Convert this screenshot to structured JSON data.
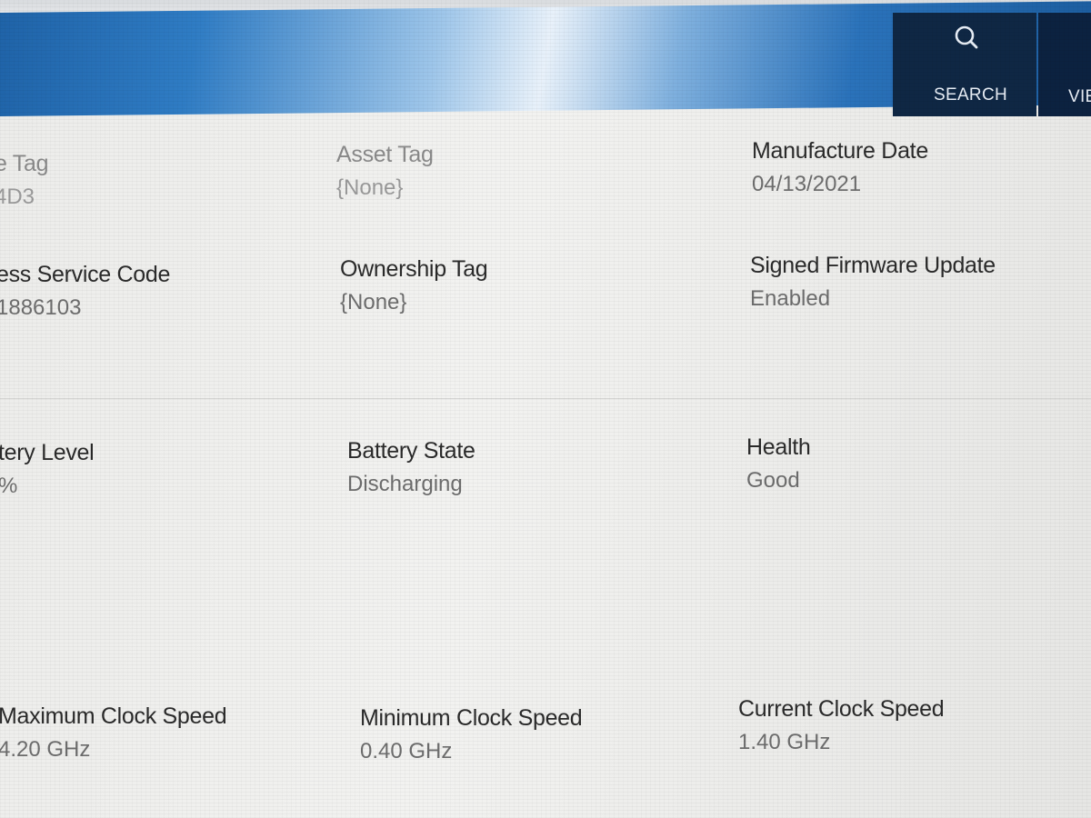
{
  "nav": {
    "search_label": "SEARCH",
    "view_label": "VIE"
  },
  "colors": {
    "header_blue": "#2f7cc4",
    "nav_dark": "#0f2744",
    "label_text": "#2a2a2a",
    "value_text": "#6d6d6d"
  },
  "icons": {
    "search": "search-icon"
  },
  "system_info": {
    "service_tag": {
      "label": "e Tag",
      "value": "4D3"
    },
    "asset_tag": {
      "label": "Asset Tag",
      "value": "{None}"
    },
    "manufacture_date": {
      "label": "Manufacture Date",
      "value": "04/13/2021"
    },
    "express_service_code": {
      "label": "ess Service Code",
      "value": "1886103"
    },
    "ownership_tag": {
      "label": "Ownership Tag",
      "value": "{None}"
    },
    "signed_firmware_update": {
      "label": "Signed Firmware Update",
      "value": "Enabled"
    }
  },
  "battery_info": {
    "battery_level": {
      "label": "tery Level",
      "value": "%"
    },
    "battery_state": {
      "label": "Battery State",
      "value": "Discharging"
    },
    "health": {
      "label": "Health",
      "value": "Good"
    }
  },
  "processor_info": {
    "maximum_clock_speed": {
      "label": "Maximum Clock Speed",
      "value": "4.20 GHz"
    },
    "minimum_clock_speed": {
      "label": "Minimum Clock Speed",
      "value": "0.40 GHz"
    },
    "current_clock_speed": {
      "label": "Current Clock Speed",
      "value": "1.40 GHz"
    }
  }
}
